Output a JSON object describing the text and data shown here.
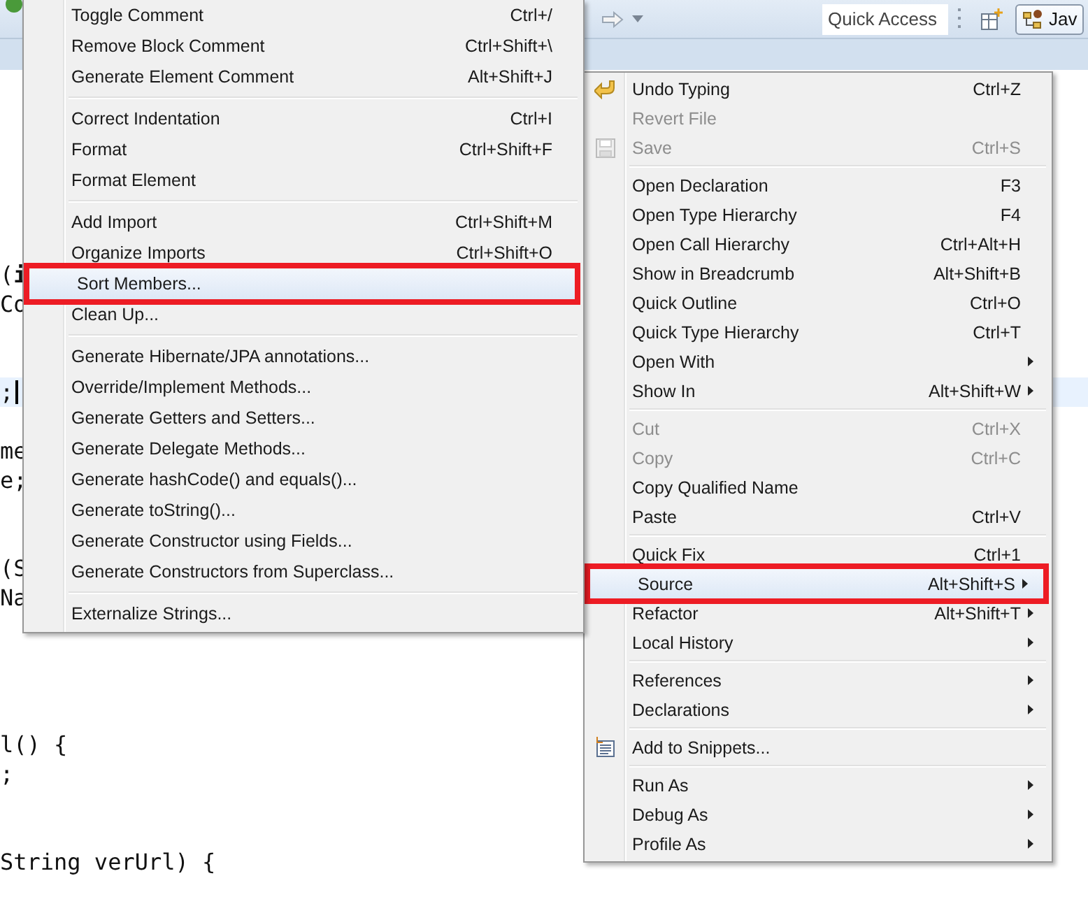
{
  "toolbar": {
    "quick_access": {
      "placeholder": "Quick Access"
    },
    "perspective": {
      "label": "Jav"
    }
  },
  "editor": {
    "code_blocks": [
      [
        {
          "text": "(**i**",
          "current": false
        },
        {
          "text": "Co",
          "current": false
        }
      ],
      [
        {
          "text": ";",
          "current": true
        }
      ],
      [
        {
          "text": "me",
          "current": false
        },
        {
          "text": "e;",
          "current": false
        }
      ],
      [
        {
          "text": "(S",
          "current": false
        },
        {
          "text": "Na",
          "current": false
        }
      ],
      [
        {
          "text": "l() {",
          "current": false
        },
        {
          "text": ";",
          "current": false
        }
      ],
      [
        {
          "text": "String verUrl) {",
          "current": false
        }
      ]
    ]
  },
  "source_menu": {
    "groups": [
      [
        {
          "label": "Toggle Comment",
          "shortcut": "Ctrl+/",
          "selected": false
        },
        {
          "label": "Remove Block Comment",
          "shortcut": "Ctrl+Shift+\\",
          "selected": false
        },
        {
          "label": "Generate Element Comment",
          "shortcut": "Alt+Shift+J",
          "selected": false
        }
      ],
      [
        {
          "label": "Correct Indentation",
          "shortcut": "Ctrl+I",
          "selected": false
        },
        {
          "label": "Format",
          "shortcut": "Ctrl+Shift+F",
          "selected": false
        },
        {
          "label": "Format Element",
          "selected": false
        }
      ],
      [
        {
          "label": "Add Import",
          "shortcut": "Ctrl+Shift+M",
          "selected": false
        },
        {
          "label": "Organize Imports",
          "shortcut": "Ctrl+Shift+O",
          "selected": false
        },
        {
          "label": "Sort Members...",
          "selected": true
        },
        {
          "label": "Clean Up...",
          "selected": false
        }
      ],
      [
        {
          "label": "Generate Hibernate/JPA annotations...",
          "selected": false
        },
        {
          "label": "Override/Implement Methods...",
          "selected": false
        },
        {
          "label": "Generate Getters and Setters...",
          "selected": false
        },
        {
          "label": "Generate Delegate Methods...",
          "selected": false
        },
        {
          "label": "Generate hashCode() and equals()...",
          "selected": false
        },
        {
          "label": "Generate toString()...",
          "selected": false
        },
        {
          "label": "Generate Constructor using Fields...",
          "selected": false
        },
        {
          "label": "Generate Constructors from Superclass...",
          "selected": false
        }
      ],
      [
        {
          "label": "Externalize Strings...",
          "selected": false
        }
      ]
    ]
  },
  "context_menu": {
    "groups": [
      [
        {
          "kind": "undo",
          "label": "Undo Typing",
          "shortcut": "Ctrl+Z",
          "selected": false,
          "disabled": false,
          "submenu": false
        },
        {
          "kind": "text",
          "label": "Revert File",
          "selected": false,
          "disabled": true,
          "submenu": false
        },
        {
          "kind": "save",
          "label": "Save",
          "shortcut": "Ctrl+S",
          "selected": false,
          "disabled": true,
          "submenu": false
        }
      ],
      [
        {
          "kind": "text",
          "label": "Open Declaration",
          "shortcut": "F3",
          "selected": false,
          "disabled": false,
          "submenu": false
        },
        {
          "kind": "text",
          "label": "Open Type Hierarchy",
          "shortcut": "F4",
          "selected": false,
          "disabled": false,
          "submenu": false
        },
        {
          "kind": "text",
          "label": "Open Call Hierarchy",
          "shortcut": "Ctrl+Alt+H",
          "selected": false,
          "disabled": false,
          "submenu": false
        },
        {
          "kind": "text",
          "label": "Show in Breadcrumb",
          "shortcut": "Alt+Shift+B",
          "selected": false,
          "disabled": false,
          "submenu": false
        },
        {
          "kind": "text",
          "label": "Quick Outline",
          "shortcut": "Ctrl+O",
          "selected": false,
          "disabled": false,
          "submenu": false
        },
        {
          "kind": "text",
          "label": "Quick Type Hierarchy",
          "shortcut": "Ctrl+T",
          "selected": false,
          "disabled": false,
          "submenu": false
        },
        {
          "kind": "text",
          "label": "Open With",
          "selected": false,
          "disabled": false,
          "submenu": true
        },
        {
          "kind": "text",
          "label": "Show In",
          "shortcut": "Alt+Shift+W",
          "selected": false,
          "disabled": false,
          "submenu": true
        }
      ],
      [
        {
          "kind": "text",
          "label": "Cut",
          "shortcut": "Ctrl+X",
          "selected": false,
          "disabled": true,
          "submenu": false
        },
        {
          "kind": "text",
          "label": "Copy",
          "shortcut": "Ctrl+C",
          "selected": false,
          "disabled": true,
          "submenu": false
        },
        {
          "kind": "text",
          "label": "Copy Qualified Name",
          "selected": false,
          "disabled": false,
          "submenu": false
        },
        {
          "kind": "text",
          "label": "Paste",
          "shortcut": "Ctrl+V",
          "selected": false,
          "disabled": false,
          "submenu": false
        }
      ],
      [
        {
          "kind": "text",
          "label": "Quick Fix",
          "shortcut": "Ctrl+1",
          "selected": false,
          "disabled": false,
          "submenu": false
        },
        {
          "kind": "text",
          "label": "Source",
          "shortcut": "Alt+Shift+S",
          "selected": true,
          "disabled": false,
          "submenu": true
        },
        {
          "kind": "text",
          "label": "Refactor",
          "shortcut": "Alt+Shift+T",
          "selected": false,
          "disabled": false,
          "submenu": true
        },
        {
          "kind": "text",
          "label": "Local History",
          "selected": false,
          "disabled": false,
          "submenu": true
        }
      ],
      [
        {
          "kind": "text",
          "label": "References",
          "selected": false,
          "disabled": false,
          "submenu": true
        },
        {
          "kind": "text",
          "label": "Declarations",
          "selected": false,
          "disabled": false,
          "submenu": true
        }
      ],
      [
        {
          "kind": "snippets",
          "label": "Add to Snippets...",
          "selected": false,
          "disabled": false,
          "submenu": false
        }
      ],
      [
        {
          "kind": "text",
          "label": "Run As",
          "selected": false,
          "disabled": false,
          "submenu": true
        },
        {
          "kind": "text",
          "label": "Debug As",
          "selected": false,
          "disabled": false,
          "submenu": true
        },
        {
          "kind": "text",
          "label": "Profile As",
          "selected": false,
          "disabled": false,
          "submenu": true
        }
      ]
    ]
  }
}
